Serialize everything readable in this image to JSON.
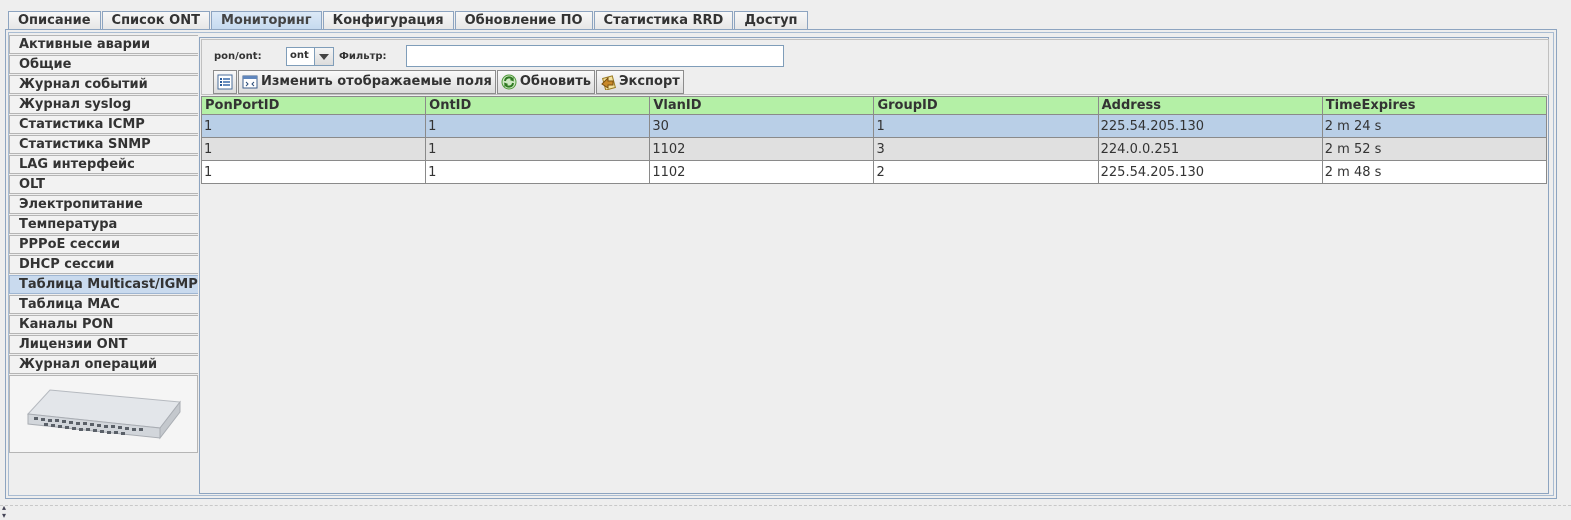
{
  "tabs": [
    {
      "label": "Описание",
      "active": false
    },
    {
      "label": "Список ONT",
      "active": false
    },
    {
      "label": "Мониторинг",
      "active": true
    },
    {
      "label": "Конфигурация",
      "active": false
    },
    {
      "label": "Обновление ПО",
      "active": false
    },
    {
      "label": "Статистика RRD",
      "active": false
    },
    {
      "label": "Доступ",
      "active": false
    }
  ],
  "sidebar": {
    "items": [
      {
        "label": "Активные аварии"
      },
      {
        "label": "Общие"
      },
      {
        "label": "Журнал событий"
      },
      {
        "label": "Журнал syslog"
      },
      {
        "label": "Статистика ICMP"
      },
      {
        "label": "Статистика SNMP"
      },
      {
        "label": "LAG интерфейс"
      },
      {
        "label": "OLT"
      },
      {
        "label": "Электропитание"
      },
      {
        "label": "Температура"
      },
      {
        "label": "PPPoE сессии"
      },
      {
        "label": "DHCP сессии"
      },
      {
        "label": "Таблица Multicast/IGMP"
      },
      {
        "label": "Таблица MAC"
      },
      {
        "label": "Каналы PON"
      },
      {
        "label": "Лицензии ONT"
      },
      {
        "label": "Журнал операций"
      }
    ],
    "active_index": 12
  },
  "filter": {
    "pon_label": "pon/ont:",
    "pon_value": "ont",
    "filter_label": "Фильтр:",
    "filter_value": ""
  },
  "toolbar": {
    "change_fields_label": "Изменить отображаемые поля",
    "refresh_label": "Обновить",
    "export_label": "Экспорт"
  },
  "table": {
    "columns": [
      "PonPortID",
      "OntID",
      "VlanID",
      "GroupID",
      "Address",
      "TimeExpires"
    ],
    "rows": [
      [
        "1",
        "1",
        "30",
        "1",
        "225.54.205.130",
        "2 m 24 s"
      ],
      [
        "1",
        "1",
        "1102",
        "3",
        "224.0.0.251",
        "2 m 52 s"
      ],
      [
        "1",
        "1",
        "1102",
        "2",
        "225.54.205.130",
        "2 m 48 s"
      ]
    ],
    "selected_row": 0
  },
  "colors": {
    "header_bg": "#b4f0a6",
    "selected_row_bg": "#b9cfe7",
    "active_tab_bg": "#c3d8ee"
  }
}
